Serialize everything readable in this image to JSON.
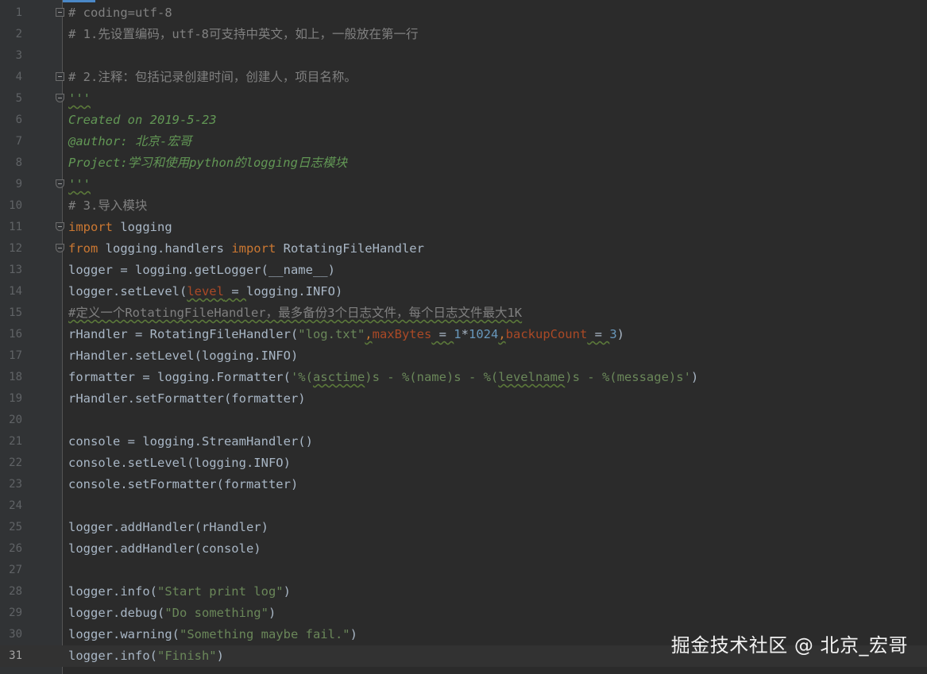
{
  "editor": {
    "current_line": 31,
    "lines": [
      {
        "n": "1",
        "fold": "start",
        "tokens": [
          {
            "t": "# coding=utf-8",
            "c": "c-com"
          }
        ]
      },
      {
        "n": "2",
        "tokens": [
          {
            "t": "# 1.先设置编码，utf-8可支持中英文，如上，一般放在第一行",
            "c": "c-com"
          }
        ]
      },
      {
        "n": "3",
        "tokens": []
      },
      {
        "n": "4",
        "fold": "start",
        "tokens": [
          {
            "t": "# 2.注释：包括记录创建时间，创建人，项目名称。",
            "c": "c-com"
          }
        ]
      },
      {
        "n": "5",
        "fold": "end",
        "tokens": [
          {
            "t": "'''",
            "c": "c-doc wavy"
          }
        ]
      },
      {
        "n": "6",
        "tokens": [
          {
            "t": "Created on 2019-5-23",
            "c": "c-doc"
          }
        ]
      },
      {
        "n": "7",
        "tokens": [
          {
            "t": "@author: 北京-宏哥",
            "c": "c-doc"
          }
        ]
      },
      {
        "n": "8",
        "tokens": [
          {
            "t": "Project:学习和使用python的logging日志模块",
            "c": "c-doc"
          }
        ]
      },
      {
        "n": "9",
        "fold": "end",
        "tokens": [
          {
            "t": "'''",
            "c": "c-doc wavy"
          }
        ]
      },
      {
        "n": "10",
        "tokens": [
          {
            "t": "# 3.导入模块",
            "c": "c-com"
          }
        ]
      },
      {
        "n": "11",
        "fold": "end",
        "tokens": [
          {
            "t": "import",
            "c": "c-kw"
          },
          {
            "t": " logging",
            "c": ""
          }
        ]
      },
      {
        "n": "12",
        "fold": "end",
        "tokens": [
          {
            "t": "from",
            "c": "c-kw"
          },
          {
            "t": " logging.handlers ",
            "c": ""
          },
          {
            "t": "import",
            "c": "c-kw"
          },
          {
            "t": " RotatingFileHandler",
            "c": ""
          }
        ]
      },
      {
        "n": "13",
        "tokens": [
          {
            "t": "logger = logging.getLogger(__name__)",
            "c": ""
          }
        ]
      },
      {
        "n": "14",
        "tokens": [
          {
            "t": "logger.setLevel(",
            "c": ""
          },
          {
            "t": "level",
            "c": "c-param wavy"
          },
          {
            "t": " = ",
            "c": "wavy"
          },
          {
            "t": "logging.INFO)",
            "c": ""
          }
        ]
      },
      {
        "n": "15",
        "tokens": [
          {
            "t": "#定义一个RotatingFileHandler，最多备份3个日志文件，每个日志文件最大1K",
            "c": "c-com wavy"
          }
        ]
      },
      {
        "n": "16",
        "tokens": [
          {
            "t": "rHandler = RotatingFileHandler(",
            "c": ""
          },
          {
            "t": "\"log.txt\"",
            "c": "c-str"
          },
          {
            "t": ",",
            "c": "c-kw wavy"
          },
          {
            "t": "maxBytes",
            "c": "c-param"
          },
          {
            "t": " = ",
            "c": "wavy"
          },
          {
            "t": "1",
            "c": "c-num"
          },
          {
            "t": "*",
            "c": ""
          },
          {
            "t": "1024",
            "c": "c-num"
          },
          {
            "t": ",",
            "c": "c-kw wavy"
          },
          {
            "t": "backupCount",
            "c": "c-param"
          },
          {
            "t": " = ",
            "c": "wavy"
          },
          {
            "t": "3",
            "c": "c-num"
          },
          {
            "t": ")",
            "c": ""
          }
        ]
      },
      {
        "n": "17",
        "tokens": [
          {
            "t": "rHandler.setLevel(logging.INFO)",
            "c": ""
          }
        ]
      },
      {
        "n": "18",
        "tokens": [
          {
            "t": "formatter = logging.Formatter(",
            "c": ""
          },
          {
            "t": "'%(",
            "c": "c-str"
          },
          {
            "t": "asctime",
            "c": "c-str wavy"
          },
          {
            "t": ")s - %(name)s - %(",
            "c": "c-str"
          },
          {
            "t": "levelname",
            "c": "c-str wavy"
          },
          {
            "t": ")s - %(message)s'",
            "c": "c-str"
          },
          {
            "t": ")",
            "c": ""
          }
        ]
      },
      {
        "n": "19",
        "tokens": [
          {
            "t": "rHandler.setFormatter(formatter)",
            "c": ""
          }
        ]
      },
      {
        "n": "20",
        "tokens": []
      },
      {
        "n": "21",
        "tokens": [
          {
            "t": "console = logging.StreamHandler()",
            "c": ""
          }
        ]
      },
      {
        "n": "22",
        "tokens": [
          {
            "t": "console.setLevel(logging.INFO)",
            "c": ""
          }
        ]
      },
      {
        "n": "23",
        "tokens": [
          {
            "t": "console.setFormatter(formatter)",
            "c": ""
          }
        ]
      },
      {
        "n": "24",
        "tokens": []
      },
      {
        "n": "25",
        "tokens": [
          {
            "t": "logger.addHandler(rHandler)",
            "c": ""
          }
        ]
      },
      {
        "n": "26",
        "tokens": [
          {
            "t": "logger.addHandler(console)",
            "c": ""
          }
        ]
      },
      {
        "n": "27",
        "tokens": []
      },
      {
        "n": "28",
        "tokens": [
          {
            "t": "logger.info(",
            "c": ""
          },
          {
            "t": "\"Start print log\"",
            "c": "c-str"
          },
          {
            "t": ")",
            "c": ""
          }
        ]
      },
      {
        "n": "29",
        "tokens": [
          {
            "t": "logger.debug(",
            "c": ""
          },
          {
            "t": "\"Do something\"",
            "c": "c-str"
          },
          {
            "t": ")",
            "c": ""
          }
        ]
      },
      {
        "n": "30",
        "tokens": [
          {
            "t": "logger.warning(",
            "c": ""
          },
          {
            "t": "\"Something maybe fail.\"",
            "c": "c-str"
          },
          {
            "t": ")",
            "c": ""
          }
        ]
      },
      {
        "n": "31",
        "tokens": [
          {
            "t": "logger.info(",
            "c": ""
          },
          {
            "t": "\"Finish\"",
            "c": "c-str"
          },
          {
            "t": ")",
            "c": ""
          }
        ]
      }
    ]
  },
  "watermark": "掘金技术社区 @ 北京_宏哥",
  "colors": {
    "background": "#2b2b2b",
    "gutter": "#313335",
    "keyword": "#cc7832",
    "comment": "#808080",
    "docstring": "#629755",
    "string": "#6a8759",
    "param": "#aa4926",
    "number": "#6897bb",
    "text": "#a9b7c6"
  }
}
